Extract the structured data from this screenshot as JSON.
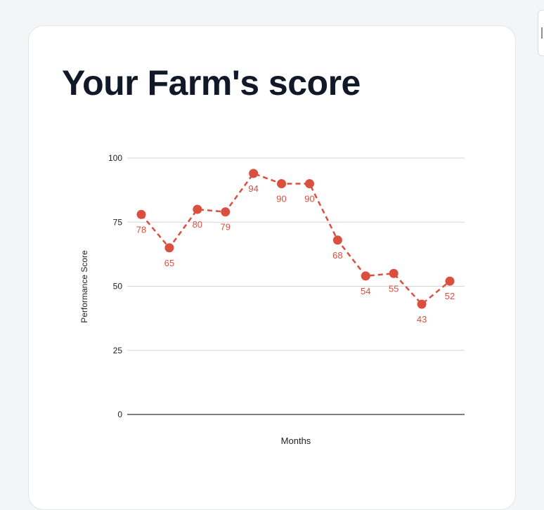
{
  "card": {
    "title": "Your Farm's score"
  },
  "colors": {
    "series": "#db4f3f",
    "grid": "#d5d5d5",
    "baseline": "#333333",
    "text": "#222222",
    "title": "#111827"
  },
  "chart_data": {
    "type": "line",
    "xlabel": "Months",
    "ylabel": "Performance Score",
    "ylim": [
      0,
      100
    ],
    "yticks": [
      0,
      25,
      50,
      75,
      100
    ],
    "grid": true,
    "series": [
      {
        "values": [
          78,
          65,
          80,
          79,
          94,
          90,
          90,
          68,
          54,
          55,
          43,
          52
        ],
        "line_style": "dashed",
        "data_labels": true
      }
    ]
  }
}
